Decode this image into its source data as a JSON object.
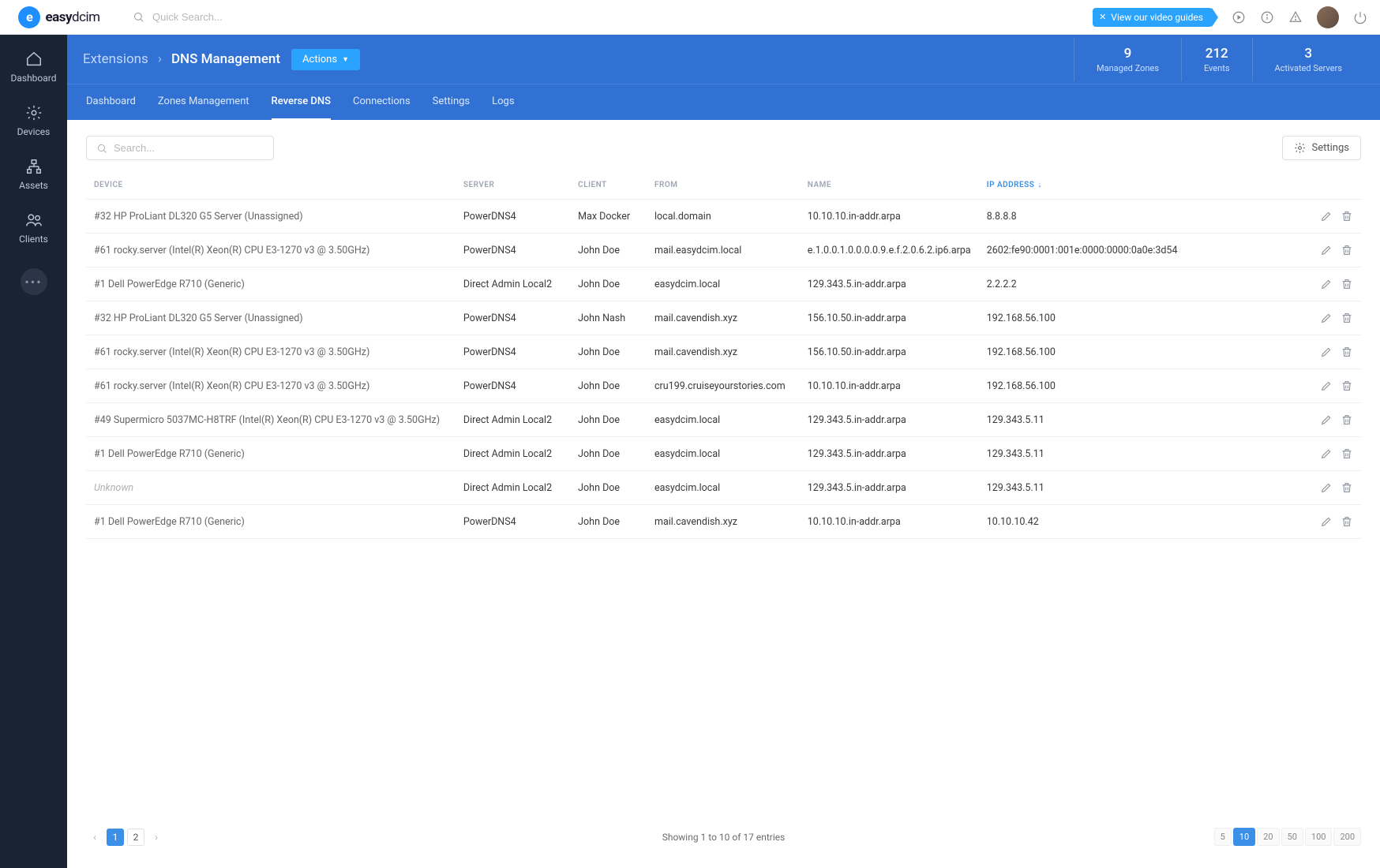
{
  "brand": {
    "bold": "easy",
    "thin": "dcim"
  },
  "topbar": {
    "search_placeholder": "Quick Search...",
    "video_guides": "View our video guides"
  },
  "sidebar": {
    "items": [
      {
        "label": "Dashboard"
      },
      {
        "label": "Devices"
      },
      {
        "label": "Assets"
      },
      {
        "label": "Clients"
      }
    ]
  },
  "header": {
    "breadcrumb_parent": "Extensions",
    "breadcrumb_current": "DNS Management",
    "actions_label": "Actions",
    "stats": [
      {
        "num": "9",
        "label": "Managed Zones"
      },
      {
        "num": "212",
        "label": "Events"
      },
      {
        "num": "3",
        "label": "Activated Servers"
      }
    ],
    "tabs": [
      {
        "label": "Dashboard",
        "active": false
      },
      {
        "label": "Zones Management",
        "active": false
      },
      {
        "label": "Reverse DNS",
        "active": true
      },
      {
        "label": "Connections",
        "active": false
      },
      {
        "label": "Settings",
        "active": false
      },
      {
        "label": "Logs",
        "active": false
      }
    ]
  },
  "toolbar": {
    "search_placeholder": "Search...",
    "settings_label": "Settings"
  },
  "table": {
    "columns": {
      "device": "DEVICE",
      "server": "SERVER",
      "client": "CLIENT",
      "from": "FROM",
      "name": "NAME",
      "ip": "IP ADDRESS"
    },
    "rows": [
      {
        "device": "#32 HP ProLiant DL320 G5 Server (Unassigned)",
        "server": "PowerDNS4",
        "client": "Max Docker",
        "from": "local.domain",
        "name": "10.10.10.in-addr.arpa",
        "ip": "8.8.8.8"
      },
      {
        "device": "#61 rocky.server (Intel(R) Xeon(R) CPU E3-1270 v3 @ 3.50GHz)",
        "server": "PowerDNS4",
        "client": "John Doe",
        "from": "mail.easydcim.local",
        "name": "e.1.0.0.1.0.0.0.0.9.e.f.2.0.6.2.ip6.arpa",
        "ip": "2602:fe90:0001:001e:0000:0000:0a0e:3d54"
      },
      {
        "device": "#1 Dell PowerEdge R710 (Generic)",
        "server": "Direct Admin Local2",
        "client": "John Doe",
        "from": "easydcim.local",
        "name": "129.343.5.in-addr.arpa",
        "ip": "2.2.2.2"
      },
      {
        "device": "#32 HP ProLiant DL320 G5 Server (Unassigned)",
        "server": "PowerDNS4",
        "client": "John Nash",
        "from": "mail.cavendish.xyz",
        "name": "156.10.50.in-addr.arpa",
        "ip": "192.168.56.100"
      },
      {
        "device": "#61 rocky.server (Intel(R) Xeon(R) CPU E3-1270 v3 @ 3.50GHz)",
        "server": "PowerDNS4",
        "client": "John Doe",
        "from": "mail.cavendish.xyz",
        "name": "156.10.50.in-addr.arpa",
        "ip": "192.168.56.100"
      },
      {
        "device": "#61 rocky.server (Intel(R) Xeon(R) CPU E3-1270 v3 @ 3.50GHz)",
        "server": "PowerDNS4",
        "client": "John Doe",
        "from": "cru199.cruiseyourstories.com",
        "name": "10.10.10.in-addr.arpa",
        "ip": "192.168.56.100"
      },
      {
        "device": "#49 Supermicro 5037MC-H8TRF (Intel(R) Xeon(R) CPU E3-1270 v3 @ 3.50GHz)",
        "server": "Direct Admin Local2",
        "client": "John Doe",
        "from": "easydcim.local",
        "name": "129.343.5.in-addr.arpa",
        "ip": "129.343.5.11"
      },
      {
        "device": "#1 Dell PowerEdge R710 (Generic)",
        "server": "Direct Admin Local2",
        "client": "John Doe",
        "from": "easydcim.local",
        "name": "129.343.5.in-addr.arpa",
        "ip": "129.343.5.11"
      },
      {
        "device": "Unknown",
        "unknown": true,
        "server": "Direct Admin Local2",
        "client": "John Doe",
        "from": "easydcim.local",
        "name": "129.343.5.in-addr.arpa",
        "ip": "129.343.5.11"
      },
      {
        "device": "#1 Dell PowerEdge R710 (Generic)",
        "server": "PowerDNS4",
        "client": "John Doe",
        "from": "mail.cavendish.xyz",
        "name": "10.10.10.in-addr.arpa",
        "ip": "10.10.10.42"
      }
    ]
  },
  "footer": {
    "pages": [
      "1",
      "2"
    ],
    "active_page": "1",
    "showing": "Showing 1 to 10 of 17 entries",
    "sizes": [
      "5",
      "10",
      "20",
      "50",
      "100",
      "200"
    ],
    "active_size": "10"
  }
}
